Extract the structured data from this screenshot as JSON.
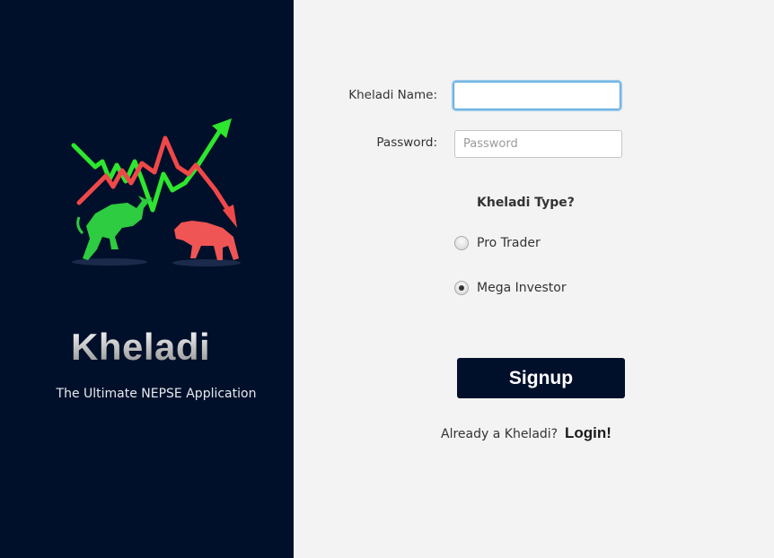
{
  "sidebar": {
    "brand": "Kheladi",
    "tagline": "The Ultimate NEPSE Application",
    "colors": {
      "background": "#00102a",
      "bull": "#2ee62e",
      "bear": "#f04848"
    },
    "logo_icon": "bull-bear-market-icon"
  },
  "form": {
    "name_label": "Kheladi Name:",
    "name_value": "",
    "password_label": "Password:",
    "password_placeholder": "Password",
    "type_question": "Kheladi Type?",
    "options": [
      {
        "label": "Pro Trader",
        "selected": false
      },
      {
        "label": "Mega Investor",
        "selected": true
      }
    ],
    "signup_label": "Signup",
    "already_text": "Already a Kheladi?",
    "login_label": "Login!"
  }
}
